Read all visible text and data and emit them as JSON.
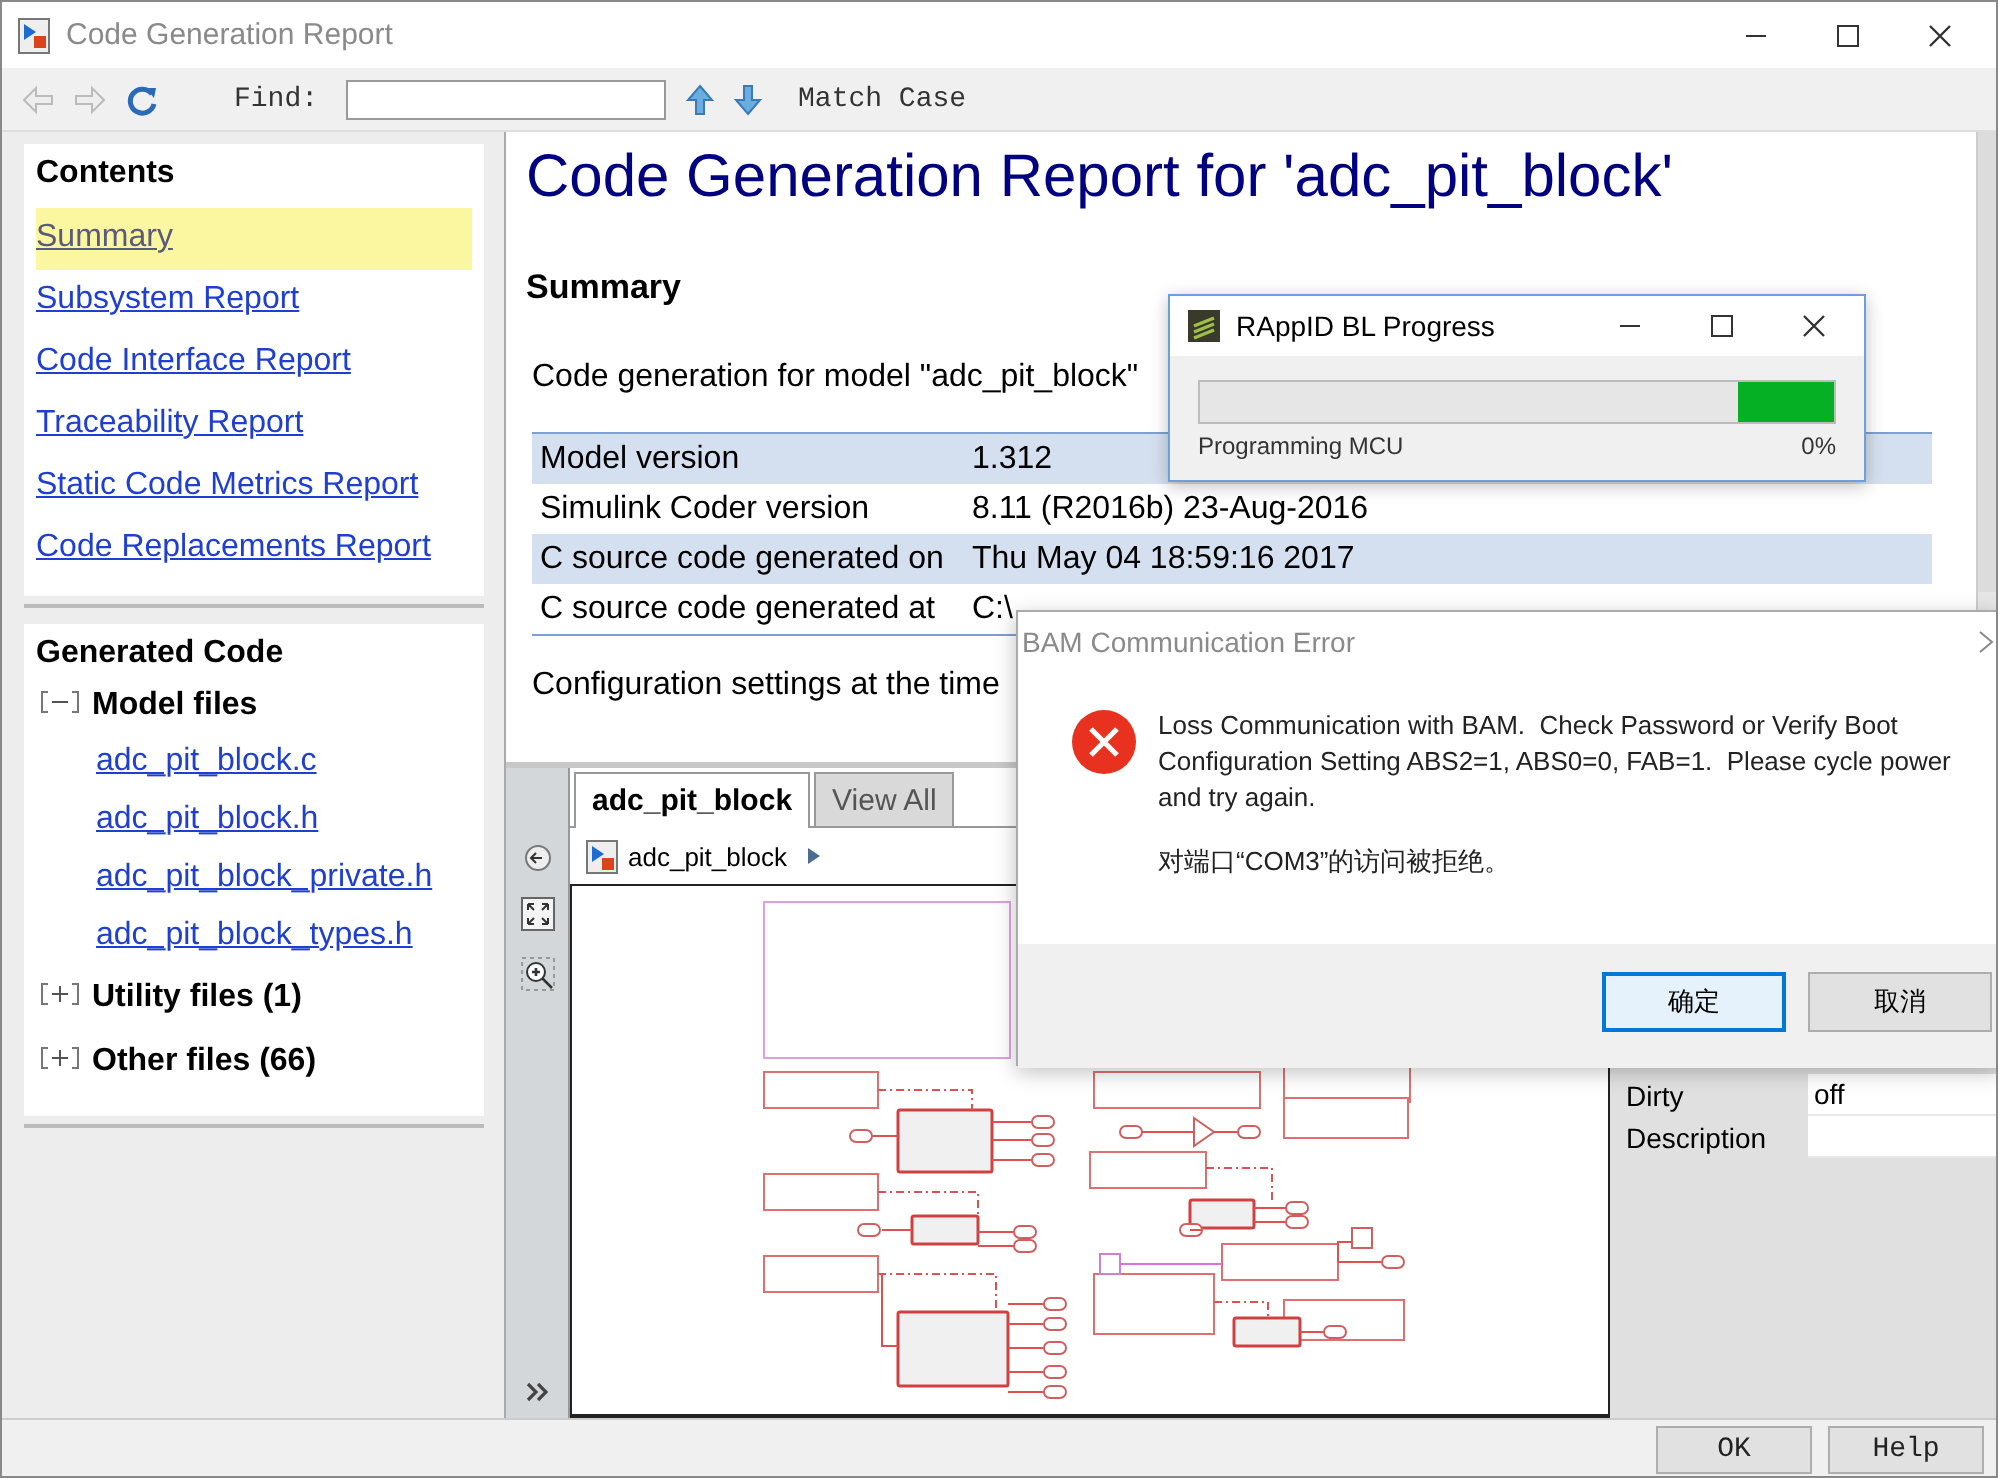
{
  "window": {
    "title": "Code Generation Report"
  },
  "toolbar": {
    "find_label": "Find:",
    "match_case": "Match Case"
  },
  "contents": {
    "title": "Contents",
    "items": [
      {
        "label": "Summary",
        "selected": true
      },
      {
        "label": "Subsystem Report",
        "selected": false
      },
      {
        "label": "Code Interface Report",
        "selected": false
      },
      {
        "label": "Traceability Report",
        "selected": false
      },
      {
        "label": "Static Code Metrics Report",
        "selected": false
      },
      {
        "label": "Code Replacements Report",
        "selected": false
      }
    ]
  },
  "generated_code": {
    "title": "Generated Code",
    "groups": [
      {
        "label": "Model files",
        "expanded": true,
        "children": [
          "adc_pit_block.c",
          "adc_pit_block.h",
          "adc_pit_block_private.h",
          "adc_pit_block_types.h"
        ]
      },
      {
        "label": "Utility files (1)",
        "expanded": false
      },
      {
        "label": "Other files (66)",
        "expanded": false
      }
    ]
  },
  "report": {
    "heading": "Code Generation Report for 'adc_pit_block'",
    "section": "Summary",
    "intro": "Code generation for model \"adc_pit_block\"",
    "rows": [
      {
        "label": "Model version",
        "value": "1.312"
      },
      {
        "label": "Simulink Coder version",
        "value": "8.11 (R2016b) 23-Aug-2016"
      },
      {
        "label": "C source code generated on",
        "value": "Thu May 04 18:59:16 2017"
      },
      {
        "label": "C source code generated at",
        "value": "C:\\"
      }
    ],
    "config_text": "Configuration settings at the time"
  },
  "model_browser": {
    "tabs": [
      {
        "label": "adc_pit_block",
        "selected": true
      },
      {
        "label": "View All",
        "selected": false
      }
    ],
    "breadcrumb": "adc_pit_block"
  },
  "properties": [
    {
      "name": "Dirty",
      "value": "off"
    },
    {
      "name": "Description"
    }
  ],
  "buttons": [
    "OK",
    "Help"
  ],
  "progress_dialog": {
    "title": "RAppID BL Progress",
    "level": 0.15,
    "status": "Programming MCU",
    "percent": "0%"
  },
  "error_dialog": {
    "title": "BAM Communication Error",
    "message": "Loss Communication with BAM.  Check Password or Verify Boot Configuration Setting ABS2=1, ABS0=0, FAB=1.  Please cycle power and try again.",
    "detail": "对端口“COM3”的访问被拒绝。",
    "buttons": [
      {
        "label": "确定",
        "selected": true
      },
      {
        "label": "取消",
        "selected": false
      }
    ]
  }
}
